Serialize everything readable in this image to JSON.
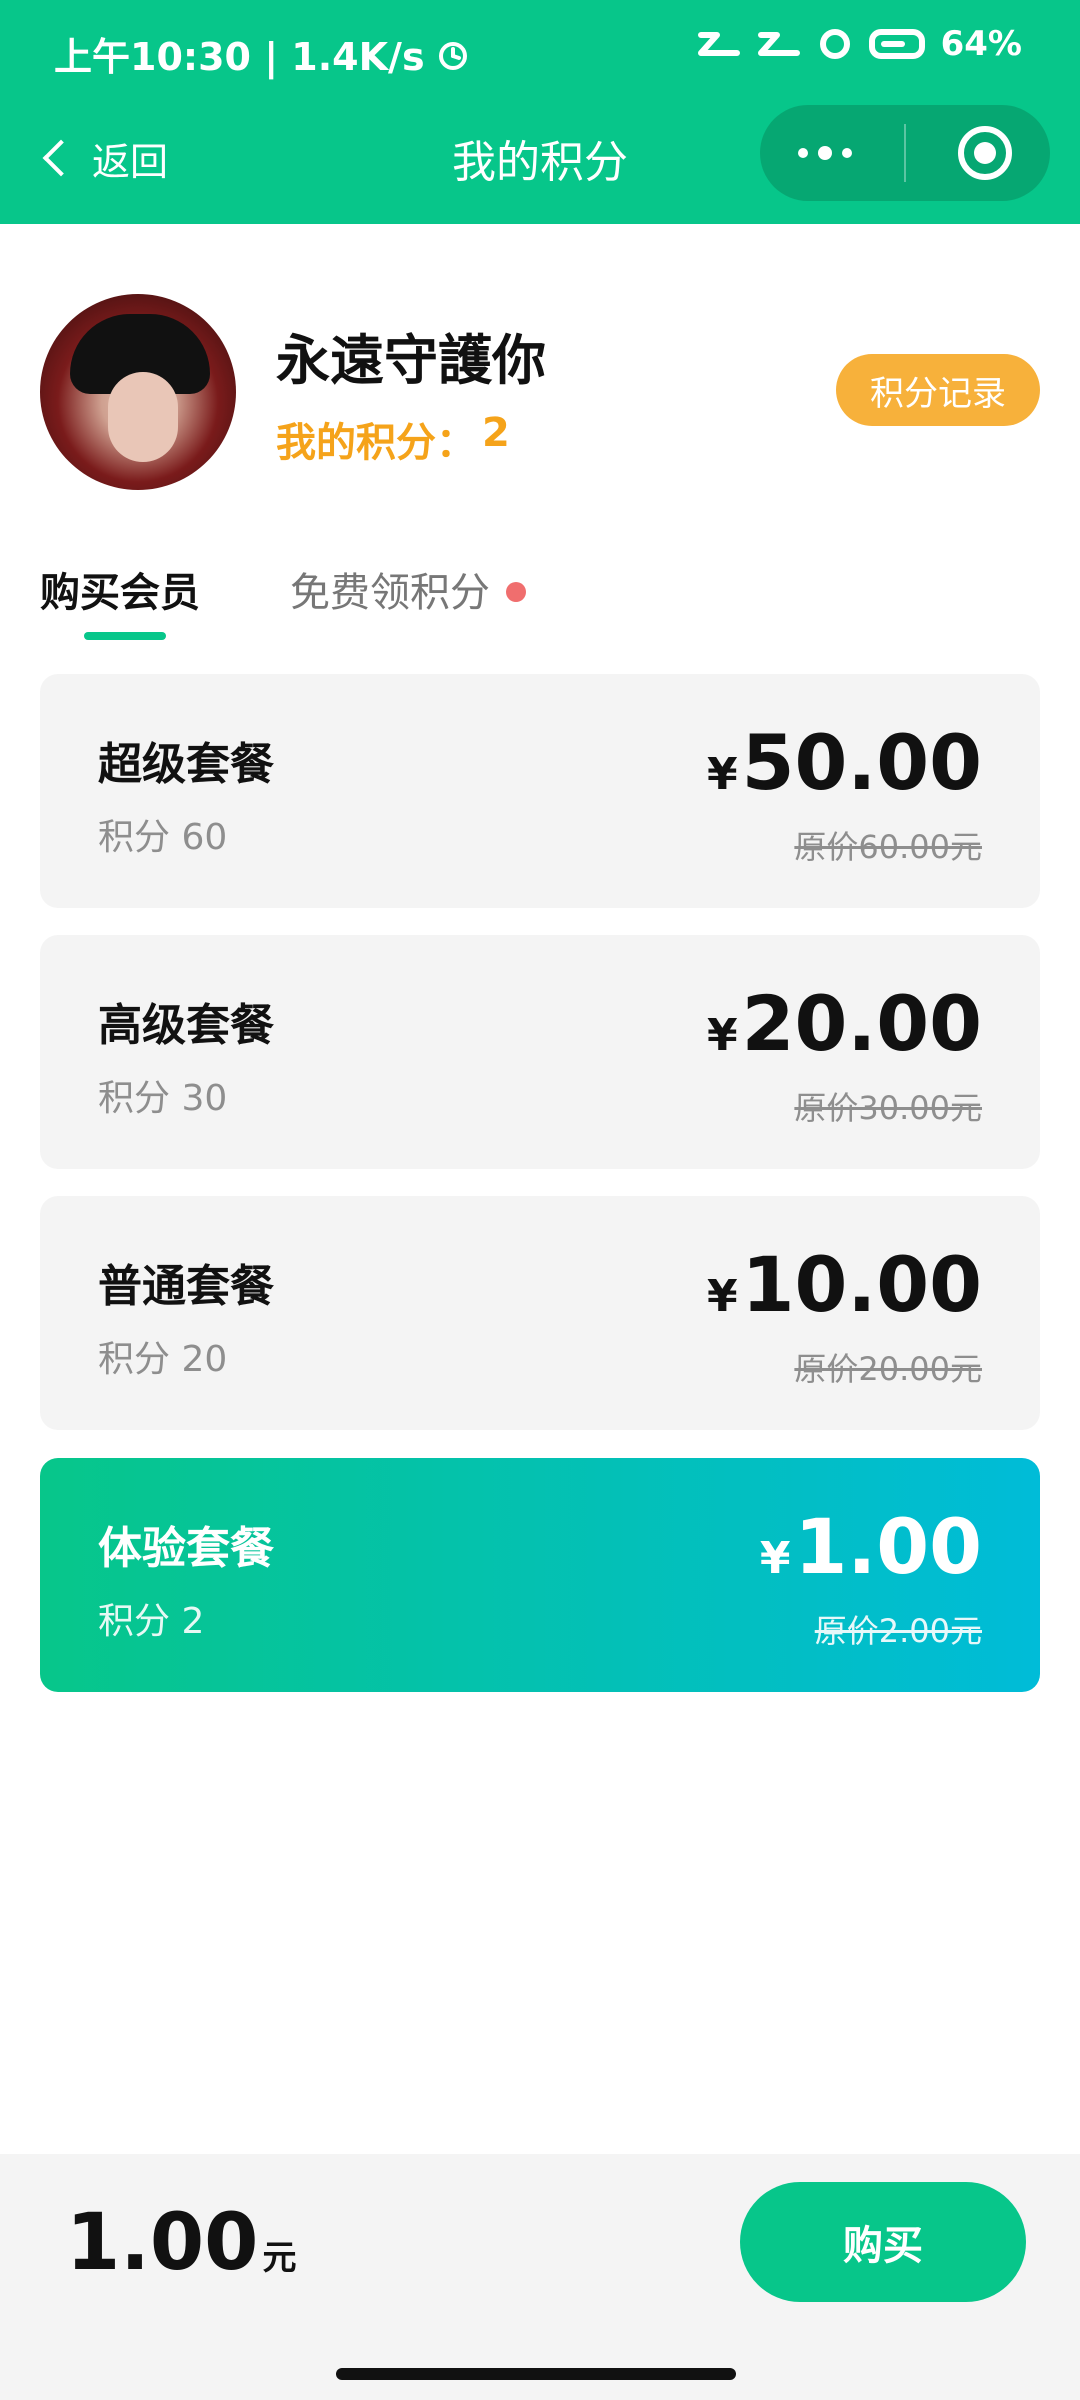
{
  "status_bar": {
    "time_speed": "上午10:30 | 1.4K/s",
    "battery": "64%"
  },
  "nav": {
    "back_label": "返回",
    "title": "我的积分"
  },
  "profile": {
    "name": "永遠守護你",
    "points_label": "我的积分：",
    "points_value": "2",
    "record_button": "积分记录"
  },
  "tabs": [
    {
      "label": "购买会员",
      "active": true
    },
    {
      "label": "免费领积分",
      "active": false
    }
  ],
  "packages": [
    {
      "title": "超级套餐",
      "points_text": "积分 60",
      "currency": "¥",
      "price": "50.00",
      "original": "原价60.00元",
      "selected": false
    },
    {
      "title": "高级套餐",
      "points_text": "积分 30",
      "currency": "¥",
      "price": "20.00",
      "original": "原价30.00元",
      "selected": false
    },
    {
      "title": "普通套餐",
      "points_text": "积分 20",
      "currency": "¥",
      "price": "10.00",
      "original": "原价20.00元",
      "selected": false
    },
    {
      "title": "体验套餐",
      "points_text": "积分 2",
      "currency": "¥",
      "price": "1.00",
      "original": "原价2.00元",
      "selected": true
    }
  ],
  "bottom": {
    "total": "1.00",
    "unit": "元",
    "buy_button": "购买"
  },
  "colors": {
    "primary": "#07c68a",
    "accent_orange": "#f5a31a",
    "card_bg": "#f4f4f4",
    "selected_gradient_end": "#00bcd8"
  },
  "icons": [
    "alarm-icon",
    "signal-icon",
    "wifi-icon",
    "battery-icon",
    "back-chevron-icon",
    "more-dots-icon",
    "target-icon"
  ]
}
